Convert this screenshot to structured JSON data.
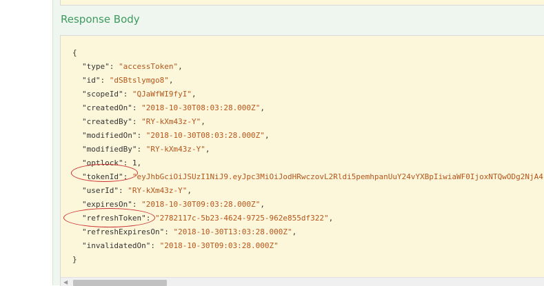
{
  "section_title": "Response Body",
  "json_lines": [
    {
      "kind": "brace",
      "text": "{"
    },
    {
      "kind": "pair",
      "key": "type",
      "value": "accessToken",
      "type": "string"
    },
    {
      "kind": "pair",
      "key": "id",
      "value": "dSBtslymgo8",
      "type": "string"
    },
    {
      "kind": "pair",
      "key": "scopeId",
      "value": "QJaWfWI9fyI",
      "type": "string"
    },
    {
      "kind": "pair",
      "key": "createdOn",
      "value": "2018-10-30T08:03:28.000Z",
      "type": "string"
    },
    {
      "kind": "pair",
      "key": "createdBy",
      "value": "RY-kXm43z-Y",
      "type": "string"
    },
    {
      "kind": "pair",
      "key": "modifiedOn",
      "value": "2018-10-30T08:03:28.000Z",
      "type": "string"
    },
    {
      "kind": "pair",
      "key": "modifiedBy",
      "value": "RY-kXm43z-Y",
      "type": "string"
    },
    {
      "kind": "pair",
      "key": "optlock",
      "value": "1",
      "type": "number"
    },
    {
      "kind": "pair",
      "key": "tokenId",
      "value": "eyJhbGciOiJSUzI1NiJ9.eyJpc3MiOiJodHRwczovL2Rldi5pemhpanUuY24vYXBpIiwiaWF0IjoxNTQwODg2NjA4",
      "type": "string",
      "highlighted": true
    },
    {
      "kind": "pair",
      "key": "userId",
      "value": "RY-kXm43z-Y",
      "type": "string"
    },
    {
      "kind": "pair",
      "key": "expiresOn",
      "value": "2018-10-30T09:03:28.000Z",
      "type": "string"
    },
    {
      "kind": "pair",
      "key": "refreshToken",
      "value": "2782117c-5b23-4624-9725-962e855df322",
      "type": "string",
      "highlighted": true
    },
    {
      "kind": "pair",
      "key": "refreshExpiresOn",
      "value": "2018-10-30T13:03:28.000Z",
      "type": "string"
    },
    {
      "kind": "pair",
      "key": "invalidatedOn",
      "value": "2018-10-30T09:03:28.000Z",
      "type": "string",
      "last": true
    },
    {
      "kind": "brace",
      "text": "}"
    }
  ],
  "colors": {
    "title": "#3e9a5e",
    "code_bg": "#fcf6da",
    "panel_bg": "#eef6ef",
    "string": "#b5551a",
    "annotation": "#cc2e2e"
  },
  "scrollbar": {
    "left_arrow_icon": "triangle-left"
  }
}
